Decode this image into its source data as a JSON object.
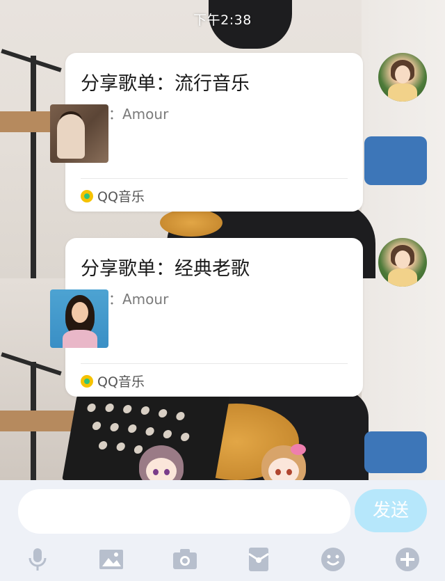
{
  "status_bar": {
    "time": "下午2:38"
  },
  "messages": [
    {
      "type": "playlist-share",
      "title": "分享歌单：流行音乐",
      "from": "来自：Amour",
      "source": "QQ音乐"
    },
    {
      "type": "playlist-share",
      "title": "分享歌单：经典老歌",
      "from": "来自：Amour",
      "source": "QQ音乐"
    }
  ],
  "composer": {
    "input_value": "",
    "input_placeholder": "",
    "send_label": "发送"
  },
  "toolbar": {
    "items": [
      {
        "icon": "microphone-icon"
      },
      {
        "icon": "image-icon"
      },
      {
        "icon": "camera-icon"
      },
      {
        "icon": "red-packet-icon"
      },
      {
        "icon": "emoji-icon"
      },
      {
        "icon": "plus-icon"
      }
    ]
  },
  "colors": {
    "send_button": "#b6e7fb",
    "toolbar_icon": "#b7bfcd",
    "qq_music_yellow": "#f5c200",
    "qq_music_green": "#31c27c"
  }
}
